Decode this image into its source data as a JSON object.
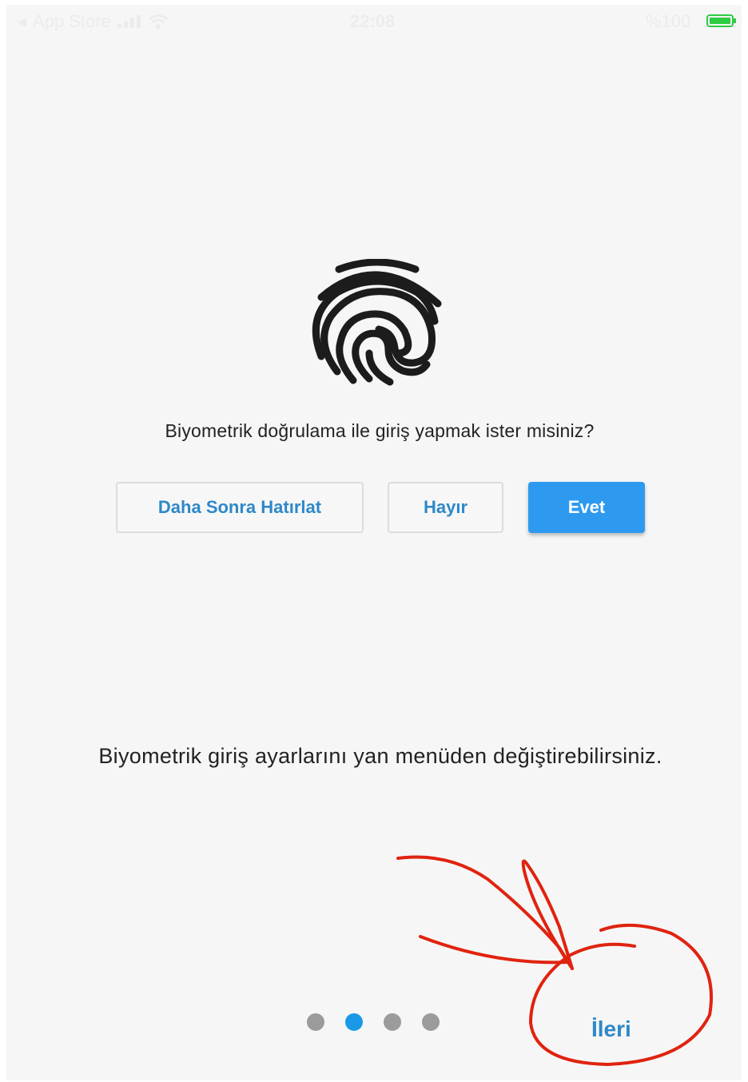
{
  "status_bar": {
    "back_label": "App Store",
    "time": "22:08",
    "battery_percent": "%100",
    "battery_color": "#2ecc40"
  },
  "icons": {
    "fingerprint": "fingerprint-icon",
    "back": "chevron-left-icon",
    "signal": "signal-icon",
    "wifi": "wifi-icon",
    "battery": "battery-icon"
  },
  "prompt": {
    "question": "Biyometrik doğrulama ile giriş yapmak ister misiniz?",
    "buttons": {
      "later": "Daha Sonra Hatırlat",
      "no": "Hayır",
      "yes": "Evet"
    }
  },
  "info_text": "Biyometrik giriş ayarlarını yan menüden değiştirebilirsiniz.",
  "pagination": {
    "total_pages": 4,
    "current_page": 2
  },
  "next_label": "İleri",
  "colors": {
    "accent": "#2d9af0",
    "link": "#2e88c9",
    "annotation": "#e0230f",
    "dot_inactive": "#9b9b9b",
    "dot_active": "#1a9ae6"
  }
}
